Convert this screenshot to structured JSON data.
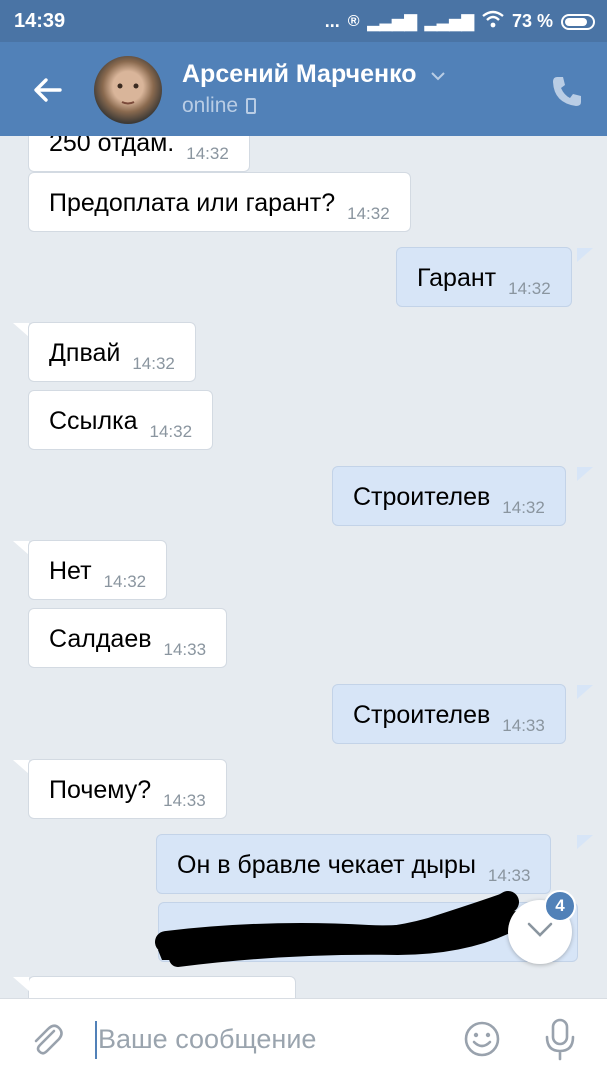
{
  "status_bar": {
    "time": "14:39",
    "dots": "...",
    "battery": "73 %"
  },
  "header": {
    "name": "Арсений Марченко",
    "status": "online"
  },
  "messages": [
    {
      "dir": "in",
      "text": "250 отдам.",
      "time": "14:32"
    },
    {
      "dir": "in",
      "text": "Предоплата или гарант?",
      "time": "14:32"
    },
    {
      "dir": "out",
      "text": "Гарант",
      "time": "14:32"
    },
    {
      "dir": "in",
      "text": "Дпвай",
      "time": "14:32"
    },
    {
      "dir": "in",
      "text": "Ссылка",
      "time": "14:32"
    },
    {
      "dir": "out",
      "text": "Строителев",
      "time": "14:32"
    },
    {
      "dir": "in",
      "text": "Нет",
      "time": "14:32"
    },
    {
      "dir": "in",
      "text": "Салдаев",
      "time": "14:33"
    },
    {
      "dir": "out",
      "text": "Строителев",
      "time": "14:33"
    },
    {
      "dir": "in",
      "text": "Почему?",
      "time": "14:33"
    },
    {
      "dir": "out",
      "text": "Он в бравле чекает дыры",
      "time": "14:33"
    }
  ],
  "scroll_down": {
    "unread_count": "4"
  },
  "composer": {
    "placeholder": "Ваше сообщение"
  },
  "colors": {
    "header": "#5181b8",
    "status_bar": "#4a74a5",
    "chat_background": "#e6ebf0",
    "incoming_bubble": "#ffffff",
    "outgoing_bubble": "#d7e5f7"
  }
}
